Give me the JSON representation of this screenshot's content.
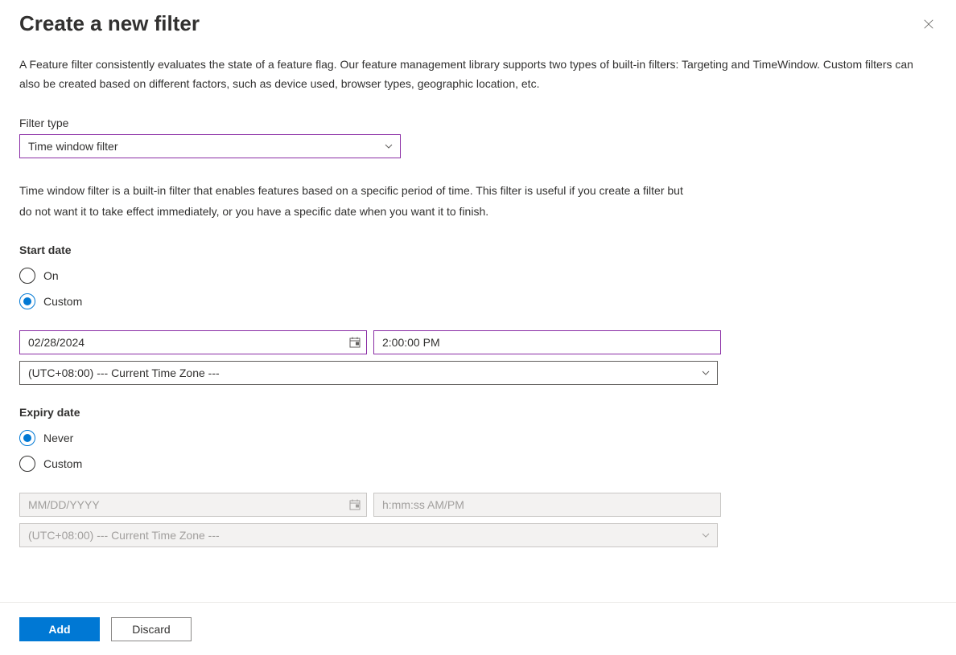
{
  "header": {
    "title": "Create a new filter"
  },
  "description": "A Feature filter consistently evaluates the state of a feature flag. Our feature management library supports two types of built-in filters: Targeting and TimeWindow. Custom filters can also be created based on different factors, such as device used, browser types, geographic location, etc.",
  "filter_type": {
    "label": "Filter type",
    "selected": "Time window filter"
  },
  "explain": "Time window filter is a built-in filter that enables features based on a specific period of time. This filter is useful if you create a filter but do not want it to take effect immediately, or you have a specific date when you want it to finish.",
  "start_date": {
    "label": "Start date",
    "options": {
      "on": "On",
      "custom": "Custom"
    },
    "selected": "custom",
    "date_value": "02/28/2024",
    "time_value": "2:00:00 PM",
    "tz_value": "(UTC+08:00) --- Current Time Zone ---"
  },
  "expiry_date": {
    "label": "Expiry date",
    "options": {
      "never": "Never",
      "custom": "Custom"
    },
    "selected": "never",
    "date_placeholder": "MM/DD/YYYY",
    "time_placeholder": "h:mm:ss AM/PM",
    "tz_value": "(UTC+08:00) --- Current Time Zone ---"
  },
  "footer": {
    "add": "Add",
    "discard": "Discard"
  }
}
